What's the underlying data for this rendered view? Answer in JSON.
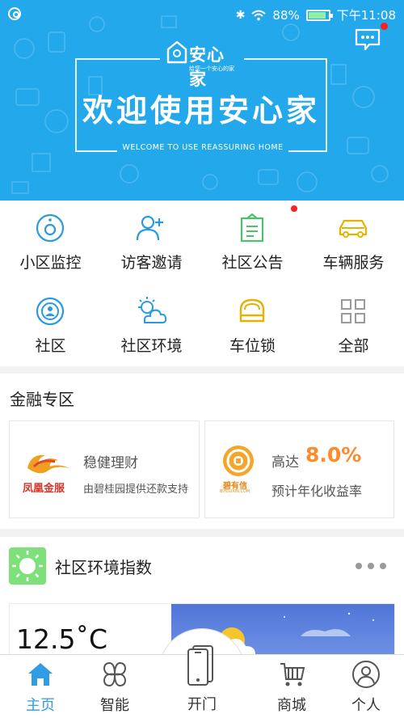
{
  "status_bar": {
    "battery": "88%",
    "time": "下午11:08",
    "bluetooth_icon": "bluetooth-icon",
    "wifi_icon": "wifi-icon"
  },
  "banner": {
    "logo_text": "安心家",
    "logo_sub": "给您一个安心的家",
    "welcome": "欢迎使用安心家",
    "welcome_en": "WELCOME TO USE REASSURING HOME",
    "bg_color": "#24a8ec"
  },
  "menu": {
    "items": [
      {
        "label": "小区监控",
        "icon": "camera-icon"
      },
      {
        "label": "访客邀请",
        "icon": "add-user-icon"
      },
      {
        "label": "社区公告",
        "icon": "notice-board-icon"
      },
      {
        "label": "车辆服务",
        "icon": "car-icon"
      },
      {
        "label": "社区",
        "icon": "community-icon"
      },
      {
        "label": "社区环境",
        "icon": "weather-icon"
      },
      {
        "label": "车位锁",
        "icon": "parking-lock-icon"
      },
      {
        "label": "全部",
        "icon": "grid-icon"
      }
    ]
  },
  "finance": {
    "title": "金融专区",
    "card1": {
      "logo_text": "凤凰金服",
      "title": "稳健理财",
      "subtitle": "由碧桂园提供还款支持"
    },
    "card2": {
      "logo_text": "碧有信",
      "logo_sub": "BIYOUXIN.COM",
      "prefix": "高达",
      "rate": "8.0%",
      "subtitle": "预计年化收益率"
    }
  },
  "environment": {
    "title": "社区环境指数",
    "temperature": "12.5˚C"
  },
  "tabbar": {
    "items": [
      {
        "label": "主页",
        "icon": "home-icon"
      },
      {
        "label": "智能",
        "icon": "clover-icon"
      },
      {
        "label": "开门",
        "icon": "phone-icon"
      },
      {
        "label": "商城",
        "icon": "cart-icon"
      },
      {
        "label": "个人",
        "icon": "user-icon"
      }
    ]
  }
}
